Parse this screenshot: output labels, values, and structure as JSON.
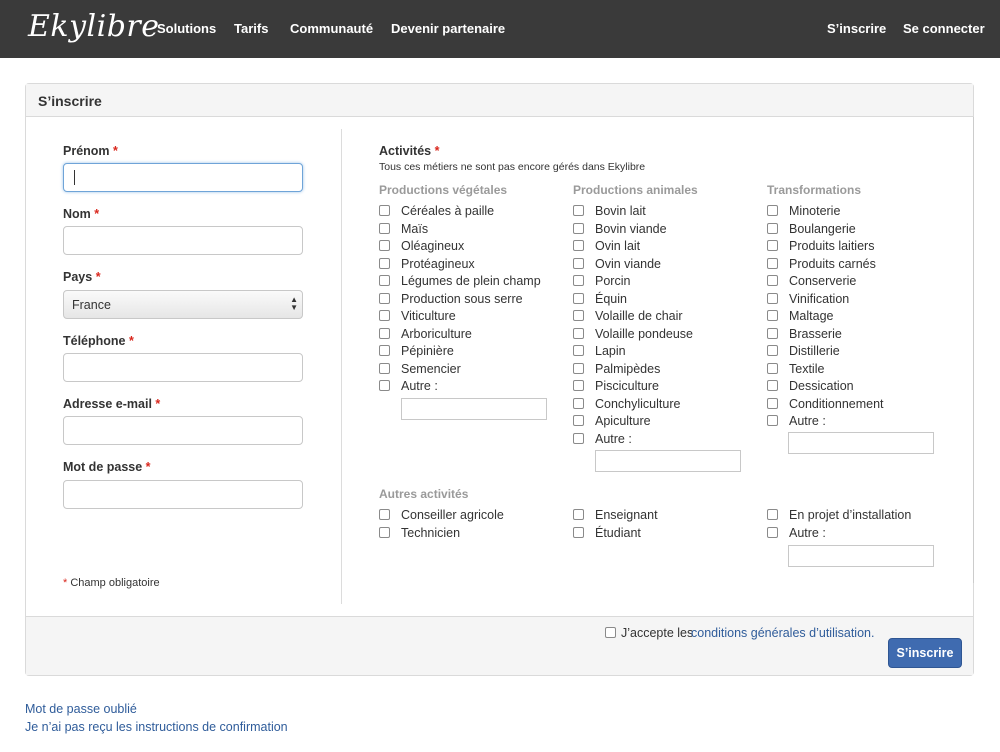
{
  "nav": {
    "brand": "Ekylibre",
    "items": [
      "Solutions",
      "Tarifs",
      "Communauté",
      "Devenir partenaire"
    ],
    "right": [
      "S’inscrire",
      "Se connecter"
    ]
  },
  "panel": {
    "title": "S’inscrire"
  },
  "form": {
    "required_mark": "*",
    "first_name_label": "Prénom",
    "last_name_label": "Nom",
    "country_label": "Pays",
    "country_value": "France",
    "phone_label": "Téléphone",
    "email_label": "Adresse e-mail",
    "password_label": "Mot de passe",
    "required_note": "Champ obligatoire"
  },
  "activities": {
    "title": "Activités",
    "note": "Tous ces métiers ne sont pas encore gérés dans Ekylibre",
    "vegetal": {
      "heading": "Productions végétales",
      "items": [
        "Céréales à paille",
        "Maïs",
        "Oléagineux",
        "Protéagineux",
        "Légumes de plein champ",
        "Production sous serre",
        "Viticulture",
        "Arboriculture",
        "Pépinière",
        "Semencier",
        "Autre :"
      ]
    },
    "animal": {
      "heading": "Productions animales",
      "items": [
        "Bovin lait",
        "Bovin viande",
        "Ovin lait",
        "Ovin viande",
        "Porcin",
        "Équin",
        "Volaille de chair",
        "Volaille pondeuse",
        "Lapin",
        "Palmipèdes",
        "Pisciculture",
        "Conchyliculture",
        "Apiculture",
        "Autre :"
      ]
    },
    "transfo": {
      "heading": "Transformations",
      "items": [
        "Minoterie",
        "Boulangerie",
        "Produits laitiers",
        "Produits carnés",
        "Conserverie",
        "Vinification",
        "Maltage",
        "Brasserie",
        "Distillerie",
        "Textile",
        "Dessication",
        "Conditionnement",
        "Autre :"
      ]
    },
    "other": {
      "heading": "Autres activités",
      "col1": [
        "Conseiller agricole",
        "Technicien"
      ],
      "col2": [
        "Enseignant",
        "Étudiant"
      ],
      "col3": [
        "En projet d’installation",
        "Autre :"
      ]
    }
  },
  "footer": {
    "accept_text": "J’accepte les",
    "accept_link": "conditions générales d’utilisation.",
    "submit": "S’inscrire"
  },
  "links": {
    "forgot_password": "Mot de passe oublié",
    "no_confirmation": "Je n’ai pas reçu les instructions de confirmation"
  }
}
